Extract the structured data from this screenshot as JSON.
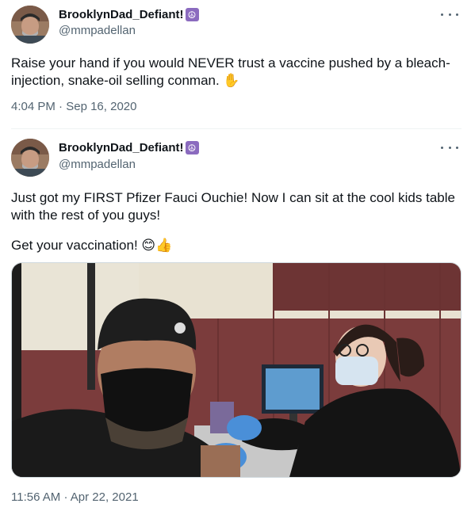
{
  "tweet1": {
    "display_name": "BrooklynDad_Defiant!",
    "badge": "☮",
    "handle": "@mmpadellan",
    "text": "Raise your hand if you would NEVER trust a vaccine pushed by a bleach-injection, snake-oil selling conman. ✋",
    "time": "4:04 PM",
    "date": "Sep 16, 2020"
  },
  "tweet2": {
    "display_name": "BrooklynDad_Defiant!",
    "badge": "☮",
    "handle": "@mmpadellan",
    "text_line1": "Just got my FIRST Pfizer Fauci Ouchie! Now I can sit at the cool kids table with the rest of you guys!",
    "text_line2": "Get your vaccination! 😊👍",
    "time": "11:56 AM",
    "date": "Apr 22, 2021",
    "image_alt": "Man in black beanie and face mask receiving a vaccine shot from a nurse in a gym"
  },
  "separator": "·",
  "icons": {
    "more": "more-horizontal-icon",
    "badge": "peace-sign-icon"
  }
}
